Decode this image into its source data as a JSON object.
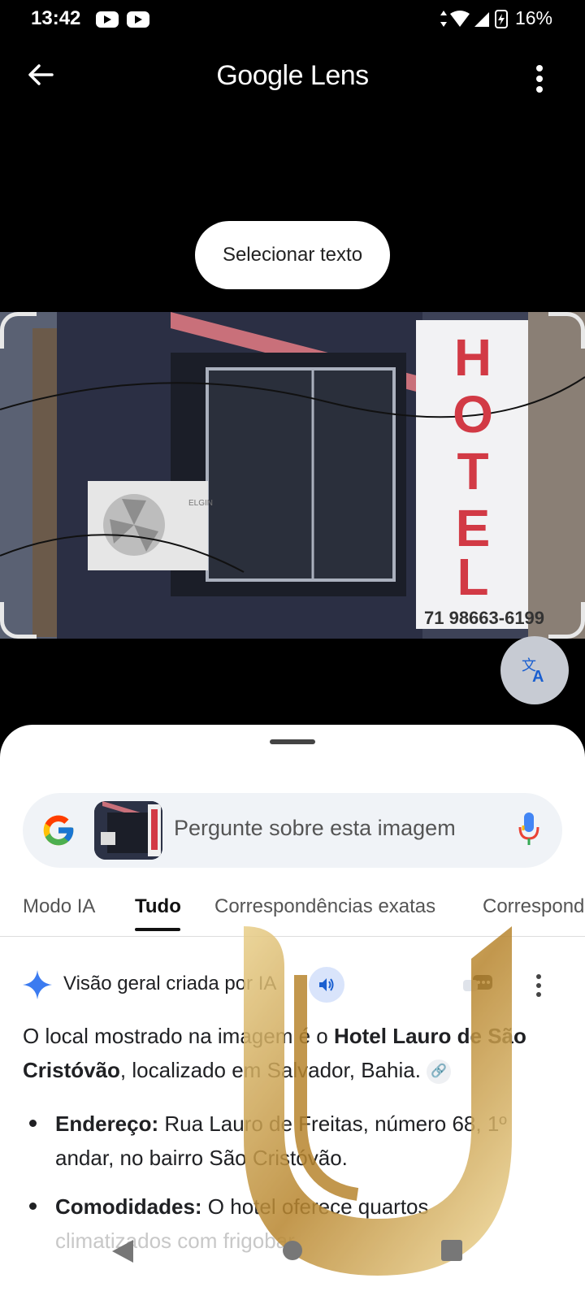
{
  "status_bar": {
    "time": "13:42",
    "battery": "16%"
  },
  "header": {
    "title": "Google Lens"
  },
  "select_text_button": "Selecionar texto",
  "photo": {
    "sign_letters": [
      "H",
      "O",
      "T",
      "E",
      "L"
    ],
    "phone": "71 98663-6199",
    "ac_brand": "ELGIN"
  },
  "search": {
    "placeholder": "Pergunte sobre esta imagem"
  },
  "tabs": [
    {
      "label": "Modo IA"
    },
    {
      "label": "Tudo"
    },
    {
      "label": "Correspondências exatas"
    },
    {
      "label": "Correspond"
    }
  ],
  "ai_overview": {
    "title": "Visão geral criada por IA",
    "intro_prefix": "O local mostrado na imagem é o ",
    "intro_bold": "Hotel Lauro de São Cristóvão",
    "intro_suffix": ", localizado em Salvador, Bahia.",
    "bullets": [
      {
        "label": "Endereço:",
        "text": " Rua Lauro de Freitas, número 68, 1º andar, no bairro São Cristóvão."
      },
      {
        "label": "Comodidades:",
        "text": " O hotel oferece quartos",
        "faded": "climatizados com frigobar"
      }
    ]
  },
  "colors": {
    "accent": "#1a73e8",
    "sheet_bg": "#ffffff",
    "watermark_gold": "#c9a24a"
  }
}
